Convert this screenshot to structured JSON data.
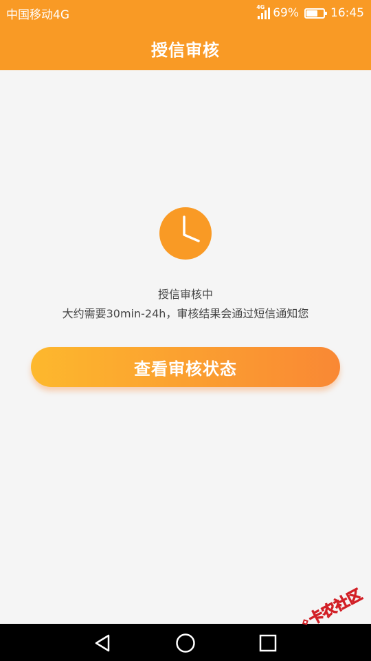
{
  "status_bar": {
    "carrier": "中国移动4G",
    "network_tag": "4G",
    "battery": "69%",
    "time": "16:45"
  },
  "header": {
    "title": "授信审核"
  },
  "main": {
    "status_title": "授信审核中",
    "status_desc": "大约需要30min-24h，审核结果会通过短信通知您",
    "button_label": "查看审核状态"
  },
  "battery_level": 0.69,
  "watermark": {
    "text": "卡农社区"
  },
  "colors": {
    "accent": "#f99a25",
    "button_start": "#fdb82d",
    "button_end": "#f98834",
    "background": "#f5f5f5",
    "nav_bar": "#000000"
  }
}
